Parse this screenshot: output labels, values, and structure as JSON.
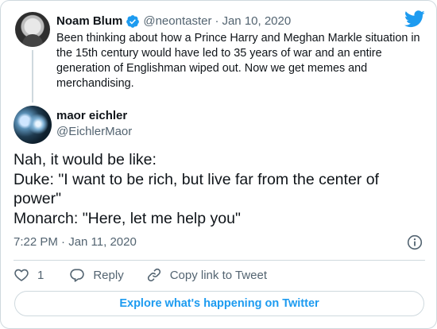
{
  "parent_tweet": {
    "name": "Noam Blum",
    "handle": "@neontaster",
    "separator": "·",
    "date": "Jan 10, 2020",
    "text": "Been thinking about how a Prince Harry and Meghan Markle situation in the 15th century would have led to 35 years of war and an entire generation of Englishman wiped out. Now we get memes and merchandising."
  },
  "tweet": {
    "name": "maor eichler",
    "handle": "@EichlerMaor",
    "lines": [
      "Nah, it would be like:",
      "Duke: \"I want to be rich, but live far from the center of power\"",
      "Monarch: \"Here, let me help you\""
    ],
    "timestamp": "7:22 PM · Jan 11, 2020"
  },
  "actions": {
    "like_count": "1",
    "reply_label": "Reply",
    "copy_link_label": "Copy link to Tweet"
  },
  "explore_label": "Explore what's happening on Twitter",
  "colors": {
    "accent": "#1d9bf0",
    "secondary_text": "#536471",
    "border": "#cfd9de"
  },
  "icons": [
    "verified-badge-icon",
    "twitter-bird-icon",
    "info-icon",
    "heart-icon",
    "reply-bubble-icon",
    "link-icon"
  ]
}
